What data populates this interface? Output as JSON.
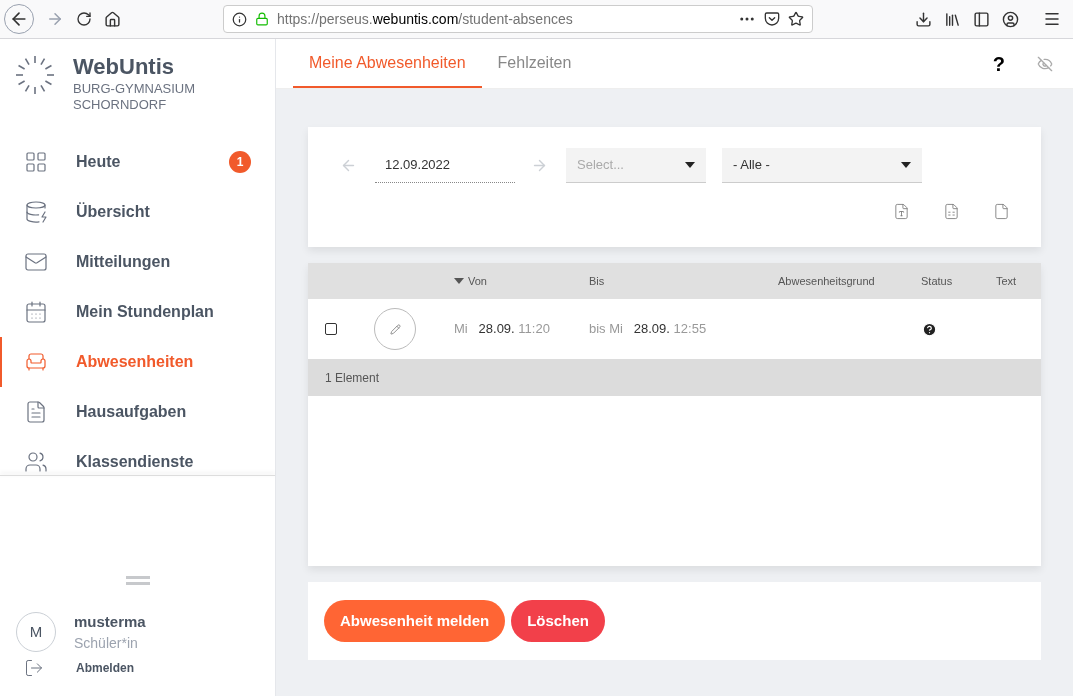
{
  "browser": {
    "url_prefix": "https://perseus.",
    "url_domain": "webuntis.com",
    "url_path": "/student-absences"
  },
  "sidebar": {
    "brand": "WebUntis",
    "school": [
      "BURG-GYMNASIUM",
      "SCHORNDORF"
    ],
    "items": [
      {
        "label": "Heute",
        "selected": false,
        "badge": "1"
      },
      {
        "label": "Übersicht",
        "selected": false
      },
      {
        "label": "Mitteilungen",
        "selected": false
      },
      {
        "label": "Mein Stundenplan",
        "selected": false
      },
      {
        "label": "Abwesenheiten",
        "selected": true
      },
      {
        "label": "Hausaufgaben",
        "selected": false
      },
      {
        "label": "Klassendienste",
        "selected": false
      }
    ],
    "user": {
      "initial": "M",
      "name": "musterma",
      "role": "Schüler*in",
      "logout": "Abmelden"
    }
  },
  "tabs": [
    {
      "label": "Meine Abwesenheiten",
      "selected": true
    },
    {
      "label": "Fehlzeiten",
      "selected": false
    }
  ],
  "help": "?",
  "filters": {
    "date": "12.09.2022",
    "select_placeholder": "Select...",
    "status_value": "- Alle -"
  },
  "table": {
    "columns": [
      {
        "label": "Von",
        "sorted": true
      },
      {
        "label": "Bis",
        "sorted": false
      },
      {
        "label": "Abwesenheitsgrund",
        "sorted": false
      },
      {
        "label": "Status",
        "sorted": false
      },
      {
        "label": "Text",
        "sorted": false
      }
    ],
    "rows": [
      {
        "checked": false,
        "from_day": "Mi",
        "from_date": "28.09.",
        "from_time": "11:20",
        "to_day": "bis Mi",
        "to_date": "28.09.",
        "to_time": "12:55"
      }
    ],
    "footer": "1 Element"
  },
  "buttons": [
    {
      "label": "Abwesenheit melden",
      "kind": "primary"
    },
    {
      "label": "Löschen",
      "kind": "danger"
    }
  ]
}
